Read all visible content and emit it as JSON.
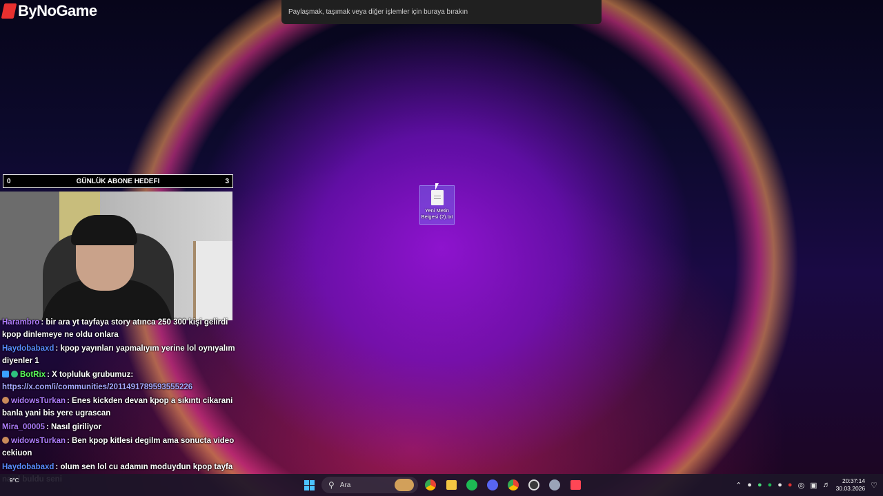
{
  "logo": {
    "text": "ByNoGame"
  },
  "notification": {
    "text": "Paylaşmak, taşımak veya diğer işlemler için buraya bırakın"
  },
  "goal_bar": {
    "left_value": "0",
    "title": "GÜNLÜK ABONE HEDEFI",
    "right_value": "3"
  },
  "desktop_icon": {
    "label": "Yeni Metin Belgesi (2).txt",
    "icon": "text-file-icon"
  },
  "chat": [
    {
      "user": "Harambro",
      "user_color": "#b07cff",
      "text": ": bir ara yt tayfaya story atınca 250 300 kişi gelirdi kpop dinlemeye ne oldu onlara",
      "badges": []
    },
    {
      "user": "Haydobabaxd",
      "user_color": "#5a8cff",
      "text": ": kpop yayınları yapmalıyım yerine lol oynıyalım diyenler 1",
      "badges": []
    },
    {
      "user": "BotRix",
      "user_color": "#5cff5c",
      "text": ": X topluluk grubumuz:",
      "link": "https://x.com/i/communities/2011491789593555226",
      "badges": [
        "bot-badge",
        "verified-badge"
      ]
    },
    {
      "user": "widowsTurkan",
      "user_color": "#b07cff",
      "text": ": Enes kickden devan kpop a sıkıntı cikarani banla yani bis yere ugrascan",
      "badges": [
        "sub-badge"
      ]
    },
    {
      "user": "Mira_00005",
      "user_color": "#b07cff",
      "text": ": Nasıl giriliyor",
      "badges": []
    },
    {
      "user": "widowsTurkan",
      "user_color": "#b07cff",
      "text": ": Ben kpop kitlesi degilm ama sonucta video cekiuon",
      "badges": [
        "sub-badge"
      ]
    },
    {
      "user": "Haydobabaxd",
      "user_color": "#5a8cff",
      "text": ": olum sen lol cu adamın moduydun kpop tayfa nasıl buldu seni",
      "badges": []
    }
  ],
  "taskbar": {
    "search_placeholder": "Ara",
    "apps": [
      "windows-start-icon",
      "chrome-icon",
      "file-explorer-icon",
      "spotify-icon",
      "discord-icon",
      "chrome-alt-icon",
      "obs-icon",
      "app-icon",
      "valorant-icon"
    ],
    "weather": "9°C",
    "time": "20:37:14",
    "date": "30.03.2026"
  }
}
